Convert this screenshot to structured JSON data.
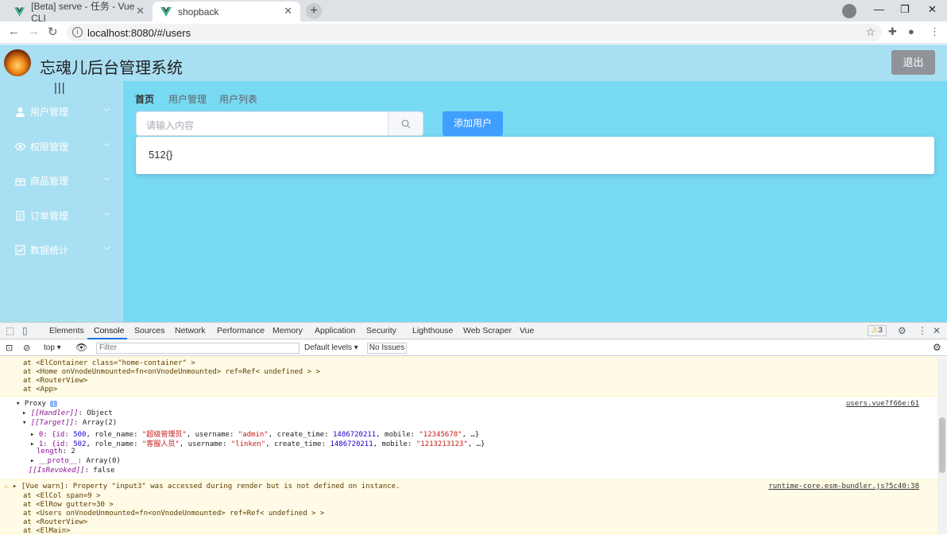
{
  "browser": {
    "tabs": [
      {
        "title": "[Beta] serve - 任务 - Vue CLI",
        "active": false
      },
      {
        "title": "shopback",
        "active": true
      }
    ],
    "url": "localhost:8080/#/users"
  },
  "app": {
    "title": "忘魂儿后台管理系统",
    "logout_label": "退出",
    "toggle_label": "|||",
    "menu": [
      {
        "label": "用户管理",
        "icon": "user-icon"
      },
      {
        "label": "权限管理",
        "icon": "eye-icon"
      },
      {
        "label": "商品管理",
        "icon": "gift-icon"
      },
      {
        "label": "订单管理",
        "icon": "document-icon"
      },
      {
        "label": "数据统计",
        "icon": "chart-icon"
      }
    ],
    "breadcrumb": [
      "首页",
      "用户管理",
      "用户列表"
    ],
    "search_placeholder": "请输入内容",
    "add_user_label": "添加用户",
    "card_text": "512{}"
  },
  "devtools": {
    "tabs": [
      "Elements",
      "Console",
      "Sources",
      "Network",
      "Performance",
      "Memory",
      "Application",
      "Security",
      "Lighthouse",
      "Web Scraper",
      "Vue"
    ],
    "warning_count": "3",
    "context": "top",
    "filter_placeholder": "Filter",
    "levels_label": "Default levels",
    "issues_label": "No Issues",
    "lines": {
      "a1": "at <ElContainer class=\"home-container\" >",
      "a2": "at <Home onVnodeUnmounted=fn<onVnodeUnmounted> ref=Ref< undefined > >",
      "a3": "at <RouterView>",
      "a4": "at <App>",
      "proxy": "Proxy",
      "handler_key": "[[Handler]]",
      "handler_val": ": Object",
      "target_key": "[[Target]]",
      "target_val": ": Array(2)",
      "row0_prefix": "0: {id: ",
      "row0_id": "500",
      "row0_mid1": ", role_name: ",
      "row0_role": "\"超级管理员\"",
      "row0_mid2": ", username: ",
      "row0_user": "\"admin\"",
      "row0_mid3": ", create_time: ",
      "row0_time": "1486720211",
      "row0_mid4": ", mobile: ",
      "row0_mobile": "\"12345678\"",
      "row0_end": ", …}",
      "row1_prefix": "1: {id: ",
      "row1_id": "502",
      "row1_mid1": ", role_name: ",
      "row1_role": "\"客服人员\"",
      "row1_mid2": ", username: ",
      "row1_user": "\"linken\"",
      "row1_mid3": ", create_time: ",
      "row1_time": "1486720211",
      "row1_mid4": ", mobile: ",
      "row1_mobile": "\"1213213123\"",
      "row1_end": ", …}",
      "length_key": "length",
      "length_val": ": 2",
      "proto_key": "__proto__",
      "proto_val": ": Array(0)",
      "revoked_key": "[[IsRevoked]]",
      "revoked_val": ": false",
      "src1": "users.vue?f66e:61",
      "warn_msg": "[Vue warn]: Property \"input3\" was accessed during render but is not defined on instance.",
      "src2": "runtime-core.esm-bundler.js?5c40:38",
      "b1": "at <ElCol span=9 >",
      "b2": "at <ElRow gutter=30 >",
      "b3": "at <Users onVnodeUnmounted=fn<onVnodeUnmounted> ref=Ref< undefined > >",
      "b4": "at <RouterView>",
      "b5": "at <ElMain>"
    }
  },
  "colors": {
    "header_bg": "#a9dff2",
    "main_bg": "#78d9f3",
    "primary": "#409eff",
    "logout_bg": "#909399"
  }
}
